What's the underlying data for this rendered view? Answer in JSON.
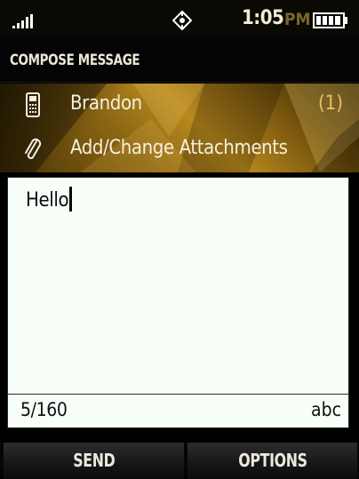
{
  "status_bar": {
    "time": "1:05",
    "ampm": "PM",
    "icons": [
      "signal-icon",
      "gps-icon",
      "battery-icon"
    ]
  },
  "title_bar": {
    "title": "COMPOSE MESSAGE"
  },
  "recipient": {
    "name": "Brandon",
    "count": "(1)",
    "icon": "phone-icon"
  },
  "attachments": {
    "label": "Add/Change Attachments",
    "icon": "paperclip-icon"
  },
  "message": {
    "text": "Hello",
    "char_count": "5/160",
    "input_mode": "abc"
  },
  "softkeys": {
    "left": "SEND",
    "right": "OPTIONS"
  },
  "colors": {
    "accent_gold": "#b8891e",
    "text_light": "#f4efdf",
    "message_bg": "#f8fff8"
  }
}
